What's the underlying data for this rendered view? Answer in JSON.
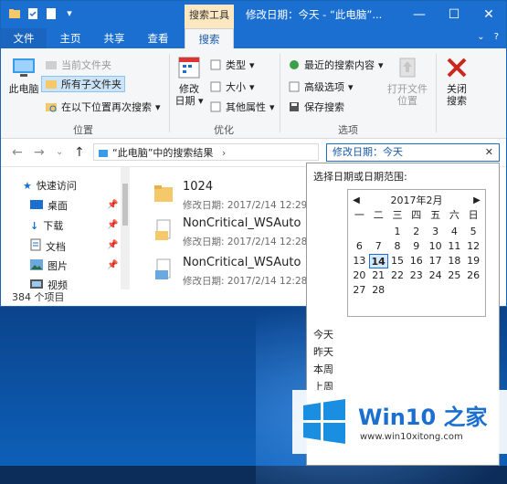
{
  "window": {
    "title": "修改日期：今天 - “此电脑”...",
    "contextual_tab": "搜索工具"
  },
  "tabs": [
    "文件",
    "主页",
    "共享",
    "查看",
    "搜索"
  ],
  "ribbon": {
    "location": {
      "label": "位置",
      "this_pc": "此电脑",
      "current_folder": "当前文件夹",
      "all_subfolders": "所有子文件夹",
      "search_again_in": "在以下位置再次搜索"
    },
    "refine": {
      "label": "优化",
      "date_modified": "修改日期",
      "kind": "类型",
      "size": "大小",
      "other_props": "其他属性"
    },
    "options": {
      "label": "选项",
      "recent_searches": "最近的搜索内容",
      "advanced_options": "高级选项",
      "save_search": "保存搜索",
      "open_file_location": "打开文件位置"
    },
    "close": {
      "close_search": "关闭搜索"
    }
  },
  "address": {
    "path": "“此电脑”中的搜索结果",
    "search_value": "修改日期：今天"
  },
  "navpane": {
    "items": [
      {
        "label": "快速访问",
        "icon": "star-icon"
      },
      {
        "label": "桌面",
        "icon": "desktop-icon"
      },
      {
        "label": "下载",
        "icon": "download-icon"
      },
      {
        "label": "文档",
        "icon": "document-icon"
      },
      {
        "label": "图片",
        "icon": "picture-icon"
      },
      {
        "label": "视频",
        "icon": "video-icon"
      }
    ]
  },
  "files": [
    {
      "name": "1024",
      "date": "修改日期: 2017/2/14 12:29"
    },
    {
      "name": "NonCritical_WSAuto",
      "date": "修改日期: 2017/2/14 12:28"
    },
    {
      "name": "NonCritical_WSAuto",
      "date": "修改日期: 2017/2/14 12:28"
    }
  ],
  "status": {
    "count": "384 个项目"
  },
  "date_picker": {
    "title": "选择日期或日期范围:",
    "month": "2017年2月",
    "weekdays": [
      "一",
      "二",
      "三",
      "四",
      "五",
      "六",
      "日"
    ],
    "weeks": [
      [
        "",
        "",
        "1",
        "2",
        "3",
        "4",
        "5"
      ],
      [
        "6",
        "7",
        "8",
        "9",
        "10",
        "11",
        "12"
      ],
      [
        "13",
        "14",
        "15",
        "16",
        "17",
        "18",
        "19"
      ],
      [
        "20",
        "21",
        "22",
        "23",
        "24",
        "25",
        "26"
      ],
      [
        "27",
        "28",
        "",
        "",
        "",
        "",
        ""
      ]
    ],
    "today": "14",
    "presets": [
      "今天",
      "昨天",
      "本周",
      "上周"
    ]
  },
  "watermark": {
    "brand": "Win10 之家",
    "url": "www.win10xitong.com"
  },
  "colors": {
    "accent": "#1a6fd1",
    "contextual": "#fce7c1"
  }
}
